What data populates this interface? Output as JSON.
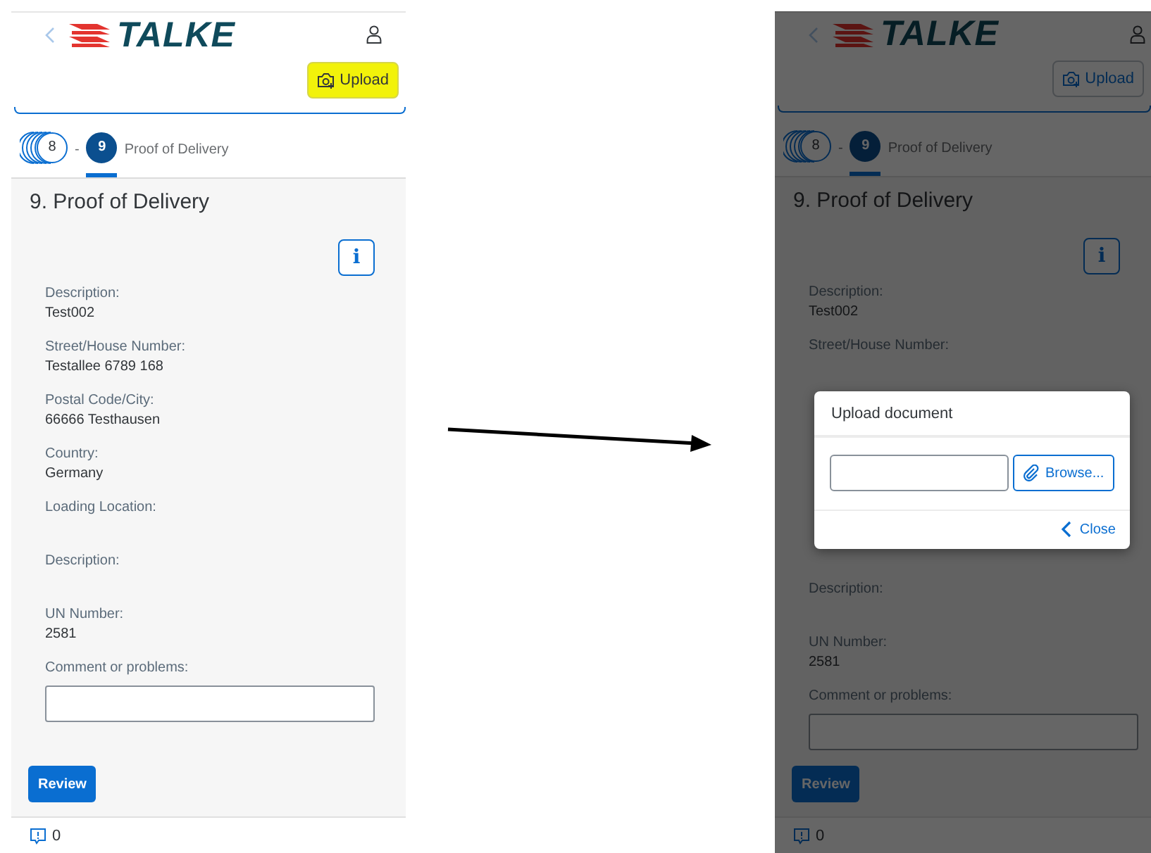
{
  "screens": [
    {
      "dimmed": false,
      "logo": "TALKE",
      "upload_button": {
        "label": "Upload",
        "highlighted": true
      },
      "steps": [
        {
          "kind": "stack",
          "number": "8",
          "selected": false
        },
        {
          "kind": "step",
          "number": "9",
          "selected": true,
          "label": "Proof of Delivery"
        }
      ],
      "step_separator": "-",
      "title": "9. Proof of Delivery",
      "info_button": "i",
      "rows": [
        {
          "kind": "field",
          "label": "Description:",
          "value": "Test002"
        },
        {
          "kind": "field",
          "label": "Street/House Number:",
          "value": "Testallee 6789 168"
        },
        {
          "kind": "field",
          "label": "Postal Code/City:",
          "value": "66666 Testhausen"
        },
        {
          "kind": "field",
          "label": "Country:",
          "value": "Germany"
        },
        {
          "kind": "field",
          "label": "Loading Location:"
        },
        {
          "kind": "field",
          "label": "Description:"
        },
        {
          "kind": "field",
          "label": "UN Number:",
          "value": "2581"
        },
        {
          "kind": "input",
          "label": "Comment or problems:"
        }
      ],
      "review_button": "Review",
      "feedback_count": "0"
    },
    {
      "dimmed": true,
      "logo": "TALKE",
      "upload_button": {
        "label": "Upload",
        "highlighted": false
      },
      "steps": [
        {
          "kind": "stack",
          "number": "8",
          "selected": false
        },
        {
          "kind": "step",
          "number": "9",
          "selected": true,
          "label": "Proof of Delivery"
        }
      ],
      "step_separator": "-",
      "title": "9. Proof of Delivery",
      "info_button": "i",
      "rows": [
        {
          "kind": "field",
          "label": "Description:",
          "value": "Test002"
        },
        {
          "kind": "field",
          "label": "Street/House Number:"
        },
        {
          "kind": "dialog",
          "title": "Upload document",
          "browse_button": "Browse...",
          "close_button": "Close"
        },
        {
          "kind": "field",
          "label": "Description:"
        },
        {
          "kind": "field",
          "label": "UN Number:",
          "value": "2581"
        },
        {
          "kind": "input",
          "label": "Comment or problems:"
        }
      ],
      "review_button": "Review",
      "feedback_count": "0"
    }
  ]
}
